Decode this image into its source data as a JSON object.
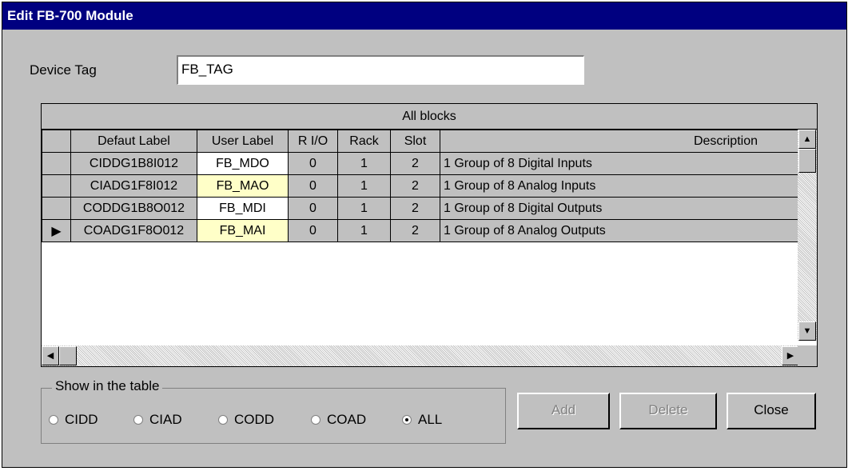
{
  "window": {
    "title": "Edit FB-700 Module"
  },
  "device_tag": {
    "label": "Device Tag",
    "value": "FB_TAG"
  },
  "table": {
    "caption": "All blocks",
    "headers": [
      "Defaut Label",
      "User Label",
      "R I/O",
      "Rack",
      "Slot",
      "Description"
    ],
    "rows": [
      {
        "default_label": "CIDDG1B8I012",
        "user_label": "FB_MDO",
        "rio": "0",
        "rack": "1",
        "slot": "2",
        "description": "1 Group of 8 Digital Inputs"
      },
      {
        "default_label": "CIADG1F8I012",
        "user_label": "FB_MAO",
        "rio": "0",
        "rack": "1",
        "slot": "2",
        "description": "1 Group of 8 Analog Inputs"
      },
      {
        "default_label": "CODDG1B8O012",
        "user_label": "FB_MDI",
        "rio": "0",
        "rack": "1",
        "slot": "2",
        "description": "1 Group of 8 Digital Outputs"
      },
      {
        "default_label": "COADG1F8O012",
        "user_label": "FB_MAI",
        "rio": "0",
        "rack": "1",
        "slot": "2",
        "description": "1 Group of 8 Analog Outputs"
      }
    ],
    "current_row_marker": "▶"
  },
  "filter": {
    "title": "Show in the table",
    "options": [
      "CIDD",
      "CIAD",
      "CODD",
      "COAD",
      "ALL"
    ],
    "selected": "ALL"
  },
  "buttons": {
    "add": "Add",
    "delete": "Delete",
    "close": "Close"
  },
  "icons": {
    "scroll_up": "▲",
    "scroll_down": "▼",
    "scroll_left": "◀",
    "scroll_right": "▶"
  }
}
